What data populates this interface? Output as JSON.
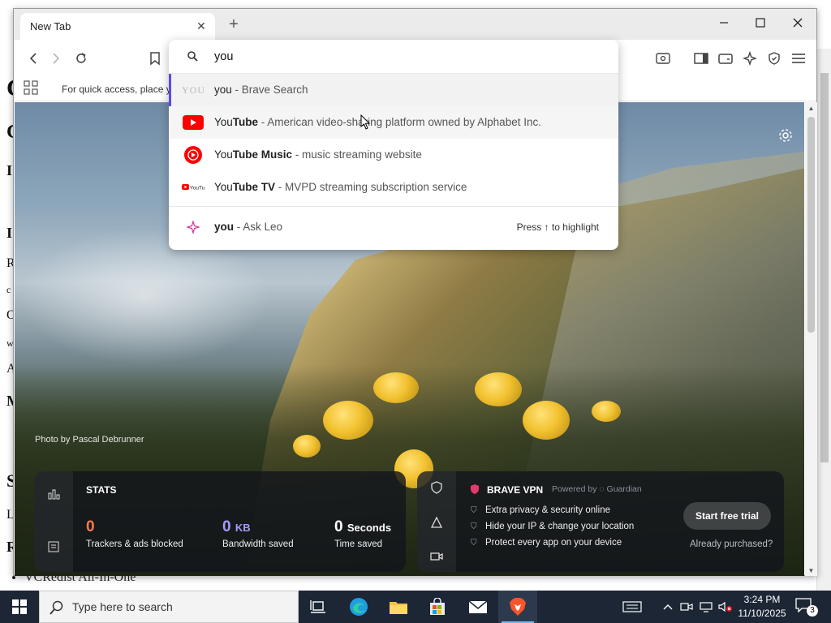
{
  "background_page": {
    "letters": [
      "C",
      "C",
      "I",
      "I",
      "R",
      "c",
      "O",
      "w",
      "A",
      "M",
      "S",
      "L",
      "R"
    ],
    "list_item": "VCRedist All-In-One"
  },
  "browser": {
    "tab": {
      "title": "New Tab"
    },
    "bookmarks_bar": {
      "text": "For quick access, place yo"
    },
    "omnibox": {
      "query": "you",
      "suggestions": [
        {
          "icon": "brave-search-icon",
          "match": "you",
          "rest": "",
          "desc": " - Brave Search",
          "bold_part": ""
        },
        {
          "icon": "youtube-icon",
          "match": "You",
          "rest": "Tube",
          "desc": " - American video-sharing platform owned by Alphabet Inc."
        },
        {
          "icon": "youtube-music-icon",
          "match": "You",
          "rest": "Tube Music",
          "desc": " - music streaming website"
        },
        {
          "icon": "youtube-tv-icon",
          "match": "You",
          "rest": "Tube TV",
          "desc": " - MVPD streaming subscription service"
        }
      ],
      "leo": {
        "icon": "leo-ai-icon",
        "query": "you",
        "desc": " - Ask Leo",
        "hint": "Press ↑ to highlight"
      }
    },
    "new_tab_page": {
      "photo_credit": "Photo by Pascal Debrunner",
      "stats": {
        "title": "STATS",
        "trackers": {
          "value": "0",
          "label": "Trackers & ads blocked",
          "color": "#ff7a4d"
        },
        "bandwidth": {
          "value": "0",
          "unit": "KB",
          "label": "Bandwidth saved",
          "color": "#a59bff"
        },
        "time": {
          "value": "0",
          "unit": "Seconds",
          "label": "Time saved",
          "color": "#ffffff"
        }
      },
      "vpn": {
        "title": "BRAVE VPN",
        "powered": "Powered by ◌ Guardian",
        "features": [
          "Extra privacy & security online",
          "Hide your IP & change your location",
          "Protect every app on your device"
        ],
        "cta": "Start free trial",
        "already": "Already purchased?"
      }
    }
  },
  "taskbar": {
    "search_placeholder": "Type here to search",
    "time": "3:24 PM",
    "date": "11/10/2025",
    "notifications": "3"
  }
}
